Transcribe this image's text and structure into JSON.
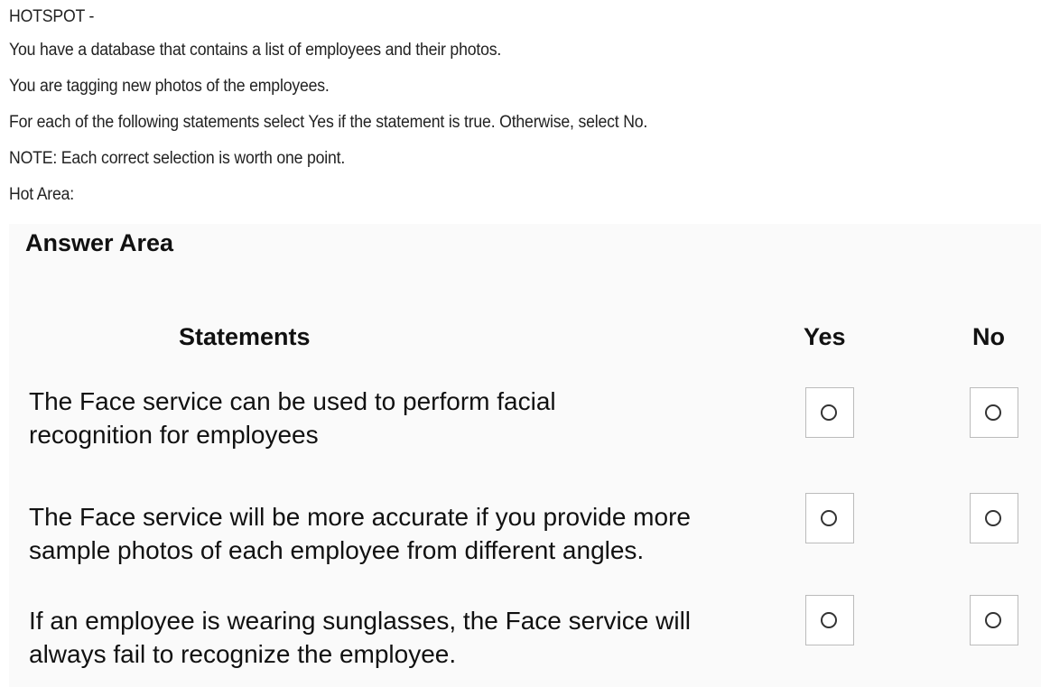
{
  "header": {
    "lines": [
      "HOTSPOT -",
      "You have a database that contains a list of employees and their photos.",
      "You are tagging new photos of the employees.",
      "For each of the following statements select Yes if the statement is true. Otherwise, select No.",
      "NOTE: Each correct selection is worth one point.",
      "Hot Area:"
    ]
  },
  "answer_area": {
    "title": "Answer Area",
    "columns": {
      "statements": "Statements",
      "yes": "Yes",
      "no": "No"
    },
    "rows": [
      {
        "statement": "The Face service can be used to perform facial recognition for employees",
        "yes_selected": false,
        "no_selected": false
      },
      {
        "statement": "The Face service will be more accurate if you provide more sample photos of each employee from different angles.",
        "yes_selected": false,
        "no_selected": false
      },
      {
        "statement": "If an employee is wearing sunglasses, the Face service will always fail to recognize the employee.",
        "yes_selected": false,
        "no_selected": false
      }
    ]
  }
}
